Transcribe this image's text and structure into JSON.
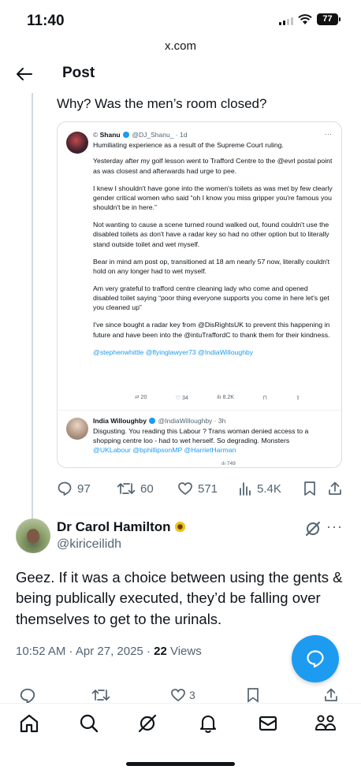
{
  "status_bar": {
    "time": "11:40",
    "battery": "77"
  },
  "browser": {
    "url": "x.com"
  },
  "header": {
    "title": "Post"
  },
  "quoted_post": {
    "question": "Why? Was the men’s room closed?",
    "embed": {
      "author_name": "Shanu",
      "author_handle": "@DJ_Shanu_",
      "time": "1d",
      "paragraphs": [
        "Humiliating experience as a result of the Supreme Court ruling.",
        "Yesterday after my golf lesson went to Trafford Centre to the @evrl postal point as was closest and afterwards had urge to pee.",
        "I knew I shouldn't have gone into the women's toilets as was met by few clearly gender critical women who said “oh I know you miss gripper you're famous you shouldn't be in here.”",
        "Not wanting to cause a scene turned round walked out, found couldn't use the disabled toilets as don't have a radar key so had no other option but to literally stand outside toilet and wet myself.",
        "Bear in mind am post op, transitioned at 18 am nearly 57 now, literally couldn't hold on any longer had to wet myself.",
        "Am very grateful to trafford centre cleaning lady who come and opened disabled toilet saying “poor thing everyone supports you come in here let's get you cleaned up”",
        "I've since bought a radar key from @DisRightsUK to prevent this happening in future and have been into the @intuTraffordC to thank them for their kindness."
      ],
      "mentions": "@stephenwhittle @flyinglawyer73 @IndiaWilloughby",
      "stats": {
        "retweets": "20",
        "likes": "34",
        "views": "8.2K"
      },
      "reply": {
        "author_name": "India Willoughby",
        "author_handle": "@IndiaWilloughby",
        "time": "3h",
        "text": "Disgusting. You reading this Labour ? Trans woman denied access to a shopping centre loo - had to wet herself. So degrading. Monsters",
        "mentions": "@UKLabour @bphillipsonMP @HarrietHarman",
        "views": "749"
      }
    },
    "stats": {
      "replies": "97",
      "reposts": "60",
      "likes": "571",
      "views": "5.4K"
    }
  },
  "main_post": {
    "author_name": "Dr Carol Hamilton",
    "author_handle": "@kiriceilidh",
    "text": "Geez. If it was a choice between using the gents & being publically executed, they’d be falling over themselves to get to the urinals.",
    "time": "10:52 AM · Apr 27, 2025 · ",
    "views_count": "22",
    "views_label": " Views",
    "likes": "3"
  },
  "nav_tabs": [
    "home-icon",
    "search-icon",
    "grok-icon",
    "notifications-icon",
    "messages-icon",
    "communities-icon"
  ]
}
